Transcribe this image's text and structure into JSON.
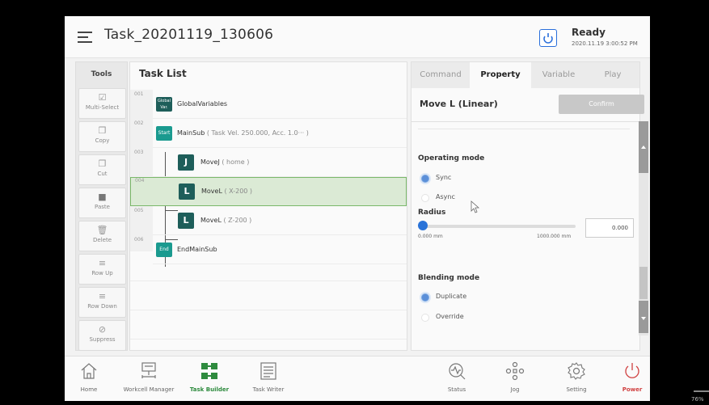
{
  "header": {
    "task_name": "Task_20201119_130606",
    "status": "Ready",
    "status_time": "2020.11.19 3:00:52 PM"
  },
  "tools": {
    "title": "Tools",
    "items": [
      {
        "label": "Multi-Select",
        "icon": "multi-select-icon"
      },
      {
        "label": "Copy",
        "icon": "copy-icon"
      },
      {
        "label": "Cut",
        "icon": "cut-icon"
      },
      {
        "label": "Paste",
        "icon": "paste-icon"
      },
      {
        "label": "Delete",
        "icon": "trash-icon"
      },
      {
        "label": "Row Up",
        "icon": "row-up-icon"
      },
      {
        "label": "Row Down",
        "icon": "row-down-icon"
      },
      {
        "label": "Suppress",
        "icon": "suppress-icon"
      }
    ]
  },
  "task_list": {
    "title": "Task List",
    "rows": [
      {
        "line": "001",
        "badge": "Global Var.",
        "name": "GlobalVariables",
        "param": ""
      },
      {
        "line": "002",
        "badge": "Start",
        "name": "MainSub",
        "param": "( Task Vel. 250.000, Acc. 1.0··· )"
      },
      {
        "line": "003",
        "badge": "J",
        "name": "MoveJ",
        "param": "( home )"
      },
      {
        "line": "004",
        "badge": "L",
        "name": "MoveL",
        "param": "( X-200 )"
      },
      {
        "line": "005",
        "badge": "L",
        "name": "MoveL",
        "param": "( Z-200 )"
      },
      {
        "line": "006",
        "badge": "End",
        "name": "EndMainSub",
        "param": ""
      }
    ],
    "selected_line": "004"
  },
  "panel": {
    "tabs": [
      "Command",
      "Property",
      "Variable",
      "Play"
    ],
    "active_tab": "Property",
    "title": "Move L (Linear)",
    "confirm_label": "Confirm",
    "operating_mode": {
      "label": "Operating mode",
      "options": [
        "Sync",
        "Async"
      ],
      "selected": "Sync"
    },
    "radius": {
      "label": "Radius",
      "min_label": "0.000 mm",
      "max_label": "1000.000 mm",
      "value": "0.000"
    },
    "blending_mode": {
      "label": "Blending mode",
      "options": [
        "Duplicate",
        "Override"
      ],
      "selected": "Duplicate"
    }
  },
  "bottom_nav": [
    {
      "label": "Home",
      "icon": "home-icon"
    },
    {
      "label": "Workcell Manager",
      "icon": "workcell-icon"
    },
    {
      "label": "Task Builder",
      "icon": "task-builder-icon",
      "active": true
    },
    {
      "label": "Task Writer",
      "icon": "task-writer-icon"
    },
    {
      "label": "Status",
      "icon": "status-icon"
    },
    {
      "label": "Jog",
      "icon": "jog-icon"
    },
    {
      "label": "Setting",
      "icon": "gear-icon"
    },
    {
      "label": "Power",
      "icon": "power-icon"
    }
  ],
  "zoom": "76%",
  "colors": {
    "accent_green": "#2e8b3e",
    "teal": "#1a9a8f",
    "dark_teal": "#1e5e5a",
    "blue": "#2a73d8",
    "power_red": "#d04040",
    "selected_row": "#dbead5"
  }
}
